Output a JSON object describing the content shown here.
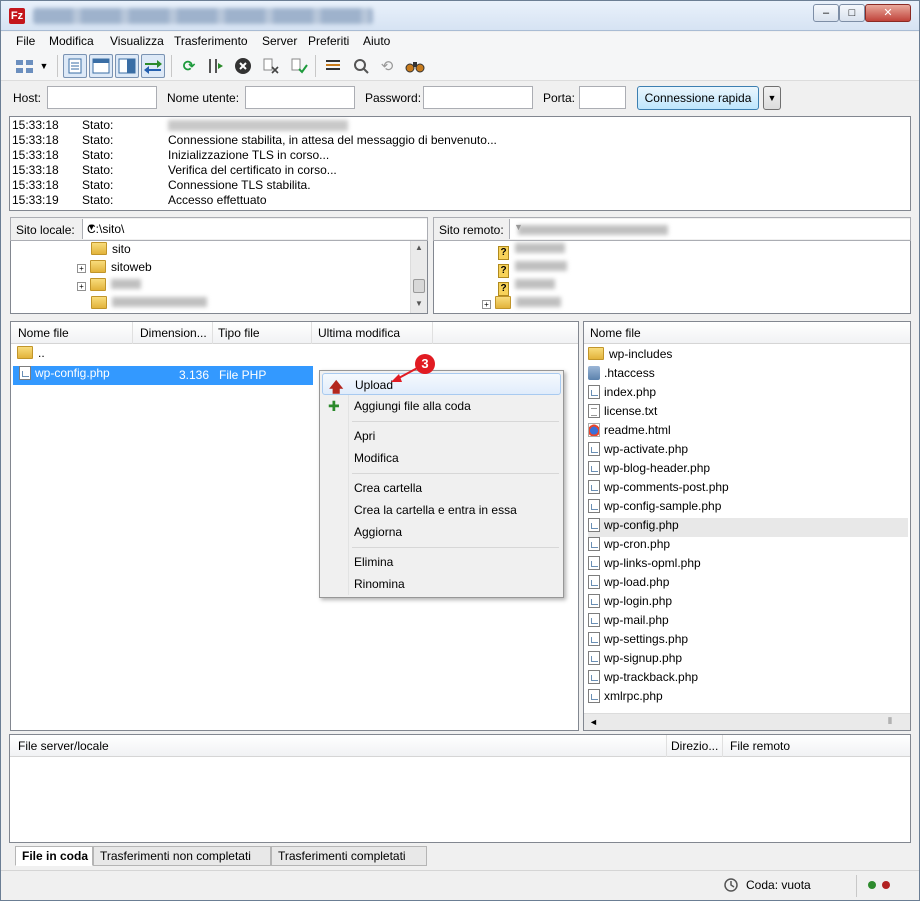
{
  "window": {
    "app_icon": "Fz",
    "controls": {
      "minimize": "–",
      "maximize": "□",
      "close": "✕"
    }
  },
  "menu": [
    "File",
    "Modifica",
    "Visualizza",
    "Trasferimento",
    "Server",
    "Preferiti",
    "Aiuto"
  ],
  "toolbar": {
    "icons": [
      "site-manager-icon",
      "dropdown-arrow-icon",
      "toggle-log-icon",
      "toggle-local-tree-icon",
      "toggle-remote-tree-icon",
      "toggle-queue-icon",
      "refresh-icon",
      "process-queue-icon",
      "cancel-icon",
      "disconnect-icon",
      "reconnect-icon",
      "filter-icon",
      "compare-icon",
      "sync-browse-icon",
      "search-binoculars-icon"
    ]
  },
  "quickconnect": {
    "host_label": "Host:",
    "user_label": "Nome utente:",
    "password_label": "Password:",
    "port_label": "Porta:",
    "connect_label": "Connessione rapida",
    "host_value": "",
    "user_value": "",
    "password_value": "",
    "port_value": ""
  },
  "log": [
    {
      "time": "15:33:18",
      "type": "Stato:",
      "msg": ""
    },
    {
      "time": "15:33:18",
      "type": "Stato:",
      "msg": "Connessione stabilita, in attesa del messaggio di benvenuto..."
    },
    {
      "time": "15:33:18",
      "type": "Stato:",
      "msg": "Inizializzazione TLS in corso..."
    },
    {
      "time": "15:33:18",
      "type": "Stato:",
      "msg": "Verifica del certificato in corso..."
    },
    {
      "time": "15:33:18",
      "type": "Stato:",
      "msg": "Connessione TLS stabilita."
    },
    {
      "time": "15:33:19",
      "type": "Stato:",
      "msg": "Accesso effettuato"
    }
  ],
  "local": {
    "site_label": "Sito locale:",
    "path": "C:\\sito\\",
    "tree": [
      {
        "name": "sito",
        "expander": ""
      },
      {
        "name": "sitoweb",
        "expander": "+"
      },
      {
        "name": "",
        "expander": "+"
      },
      {
        "name": "",
        "expander": ""
      }
    ],
    "columns": [
      "Nome file",
      "Dimension...",
      "Tipo file",
      "Ultima modifica"
    ],
    "files": [
      {
        "name": "..",
        "size": "",
        "type": ""
      },
      {
        "name": "wp-config.php",
        "size": "3.136",
        "type": "File PHP"
      }
    ]
  },
  "remote": {
    "site_label": "Sito remoto:",
    "path": "",
    "tree_expander": "+",
    "columns": [
      "Nome file"
    ],
    "files": [
      "wp-includes",
      ".htaccess",
      "index.php",
      "license.txt",
      "readme.html",
      "wp-activate.php",
      "wp-blog-header.php",
      "wp-comments-post.php",
      "wp-config-sample.php",
      "wp-config.php",
      "wp-cron.php",
      "wp-links-opml.php",
      "wp-load.php",
      "wp-login.php",
      "wp-mail.php",
      "wp-settings.php",
      "wp-signup.php",
      "wp-trackback.php",
      "xmlrpc.php"
    ]
  },
  "context_menu": {
    "items": [
      "Upload",
      "Aggiungi file alla coda",
      "Apri",
      "Modifica",
      "Crea cartella",
      "Crea la cartella e entra in essa",
      "Aggiorna",
      "Elimina",
      "Rinomina"
    ],
    "upload_icon": "up-arrow-icon",
    "queue_icon": "add-to-queue-icon"
  },
  "callout": {
    "number": "3",
    "color": "#e11b22"
  },
  "queue": {
    "columns": [
      "File server/locale",
      "Direzio...",
      "File remoto"
    ],
    "tabs": [
      "File in coda",
      "Trasferimenti non completati",
      "Trasferimenti completati"
    ]
  },
  "status": {
    "queue": "Coda: vuota"
  },
  "colors": {
    "selection": "#3399ff",
    "accent_button": "#bee6fd",
    "led_green": "#2e8b2e",
    "led_red": "#b22222"
  }
}
